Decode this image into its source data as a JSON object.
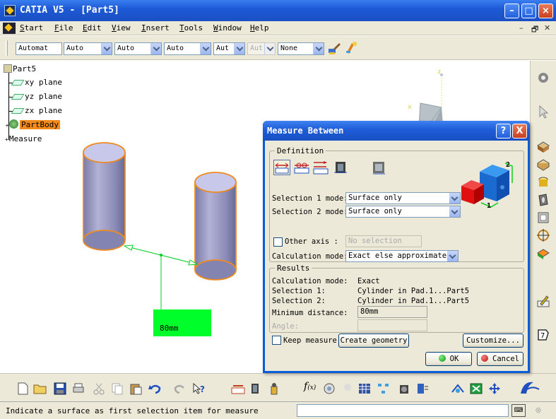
{
  "window": {
    "title": "CATIA V5 - [Part5]"
  },
  "menu": {
    "items": [
      {
        "label": "Start",
        "u": "S",
        "rest": "tart"
      },
      {
        "label": "File",
        "u": "F",
        "rest": "ile"
      },
      {
        "label": "Edit",
        "u": "E",
        "rest": "dit"
      },
      {
        "label": "View",
        "u": "V",
        "rest": "iew"
      },
      {
        "label": "Insert",
        "u": "I",
        "rest": "nsert"
      },
      {
        "label": "Tools",
        "u": "T",
        "rest": "ools"
      },
      {
        "label": "Window",
        "u": "W",
        "rest": "indow"
      },
      {
        "label": "Help",
        "u": "H",
        "rest": "elp"
      }
    ]
  },
  "combobar": {
    "combo1": "Automat",
    "combo2": "Auto",
    "combo3": "Auto",
    "combo4": "Auto",
    "combo5": "Aut",
    "combo6": "Aut",
    "combo7": "None"
  },
  "tree": {
    "root": "Part5",
    "xy": "xy plane",
    "yz": "yz plane",
    "zx": "zx plane",
    "body": "PartBody",
    "measure": "Measure"
  },
  "viewport": {
    "measure_label": "80mm",
    "axis_z": "z",
    "axis_x": "x"
  },
  "dialog": {
    "title": "Measure Between",
    "help": "?",
    "close": "X",
    "definition": {
      "legend": "Definition",
      "sel1_label": "Selection 1 mode:",
      "sel1_value": "Surface only",
      "sel2_label": "Selection 2 mode:",
      "sel2_value": "Surface only",
      "other_axis_label": "Other axis :",
      "other_axis_placeholder": "No selection",
      "calc_label": "Calculation mode:",
      "calc_value": "Exact else approximate",
      "cube_label_1": "1",
      "cube_label_2": "2"
    },
    "results": {
      "legend": "Results",
      "rows": [
        {
          "label": "Calculation mode:",
          "value": "Exact"
        },
        {
          "label": "Selection 1:",
          "value": "Cylinder in Pad.1...Part5"
        },
        {
          "label": "Selection 2:",
          "value": "Cylinder in Pad.1...Part5"
        }
      ],
      "min_dist_label": "Minimum distance:",
      "min_dist_value": "80mm",
      "angle_label": "Angle:"
    },
    "keep_measure": "Keep measure",
    "create_geometry": "Create geometry",
    "customize": "Customize...",
    "ok": "OK",
    "cancel": "Cancel"
  },
  "status": {
    "text": "Indicate a surface as first selection item for measure"
  },
  "colors": {
    "title_blue": "#1d5ad6",
    "measure_green": "#00ff2a",
    "selection_orange": "#f48a1a",
    "cylinder": "#a8a8d0"
  }
}
